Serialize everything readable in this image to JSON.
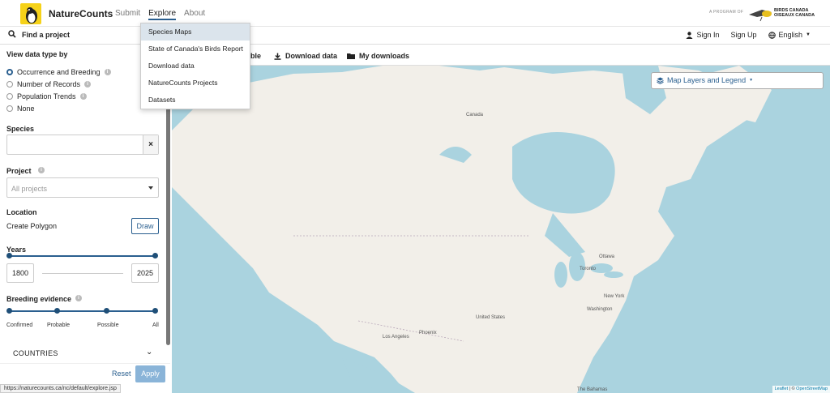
{
  "header": {
    "brand": "NatureCounts",
    "nav": [
      "Submit",
      "Explore",
      "About"
    ],
    "program_label": "A PROGRAM OF",
    "partner_line1": "BIRDS CANADA",
    "partner_line2": "OISEAUX CANADA"
  },
  "subbar": {
    "find_label": "Find a project",
    "sign_in": "Sign In",
    "sign_up": "Sign Up",
    "language": "English"
  },
  "explore_menu": {
    "items": [
      "Species Maps",
      "State of Canada's Birds Report",
      "Download data",
      "NatureCounts Projects",
      "Datasets"
    ]
  },
  "sidebar": {
    "view_type_title": "View data type by",
    "view_types": [
      "Occurrence and Breeding",
      "Number of Records",
      "Population Trends",
      "None"
    ],
    "species_title": "Species",
    "species_value": "",
    "species_clear": "×",
    "project_title": "Project",
    "project_value": "All projects",
    "location_title": "Location",
    "create_polygon": "Create Polygon",
    "draw_label": "Draw",
    "years_title": "Years",
    "year_from": "1800",
    "year_to": "2025",
    "breeding_title": "Breeding evidence",
    "breeding_levels": [
      "Confirmed",
      "Probable",
      "Possible",
      "All"
    ],
    "countries_label": "COUNTRIES",
    "reset_label": "Reset",
    "apply_label": "Apply"
  },
  "toolbar": {
    "partial_item": "ble",
    "download_label": "Download data",
    "my_downloads_label": "My downloads"
  },
  "map": {
    "layers_label": "Map Layers and Legend",
    "places": [
      "Canada",
      "Ottawa",
      "Toronto",
      "New York",
      "Washington",
      "United States",
      "Los Angeles",
      "Phoenix",
      "The Bahamas"
    ],
    "attribution_leaflet": "Leaflet",
    "attribution_sep": " | © ",
    "attribution_osm": "OpenStreetMap",
    "water_color": "#aad3df",
    "land_color": "#f2efe9"
  },
  "status_url": "https://naturecounts.ca/nc/default/explore.jsp"
}
